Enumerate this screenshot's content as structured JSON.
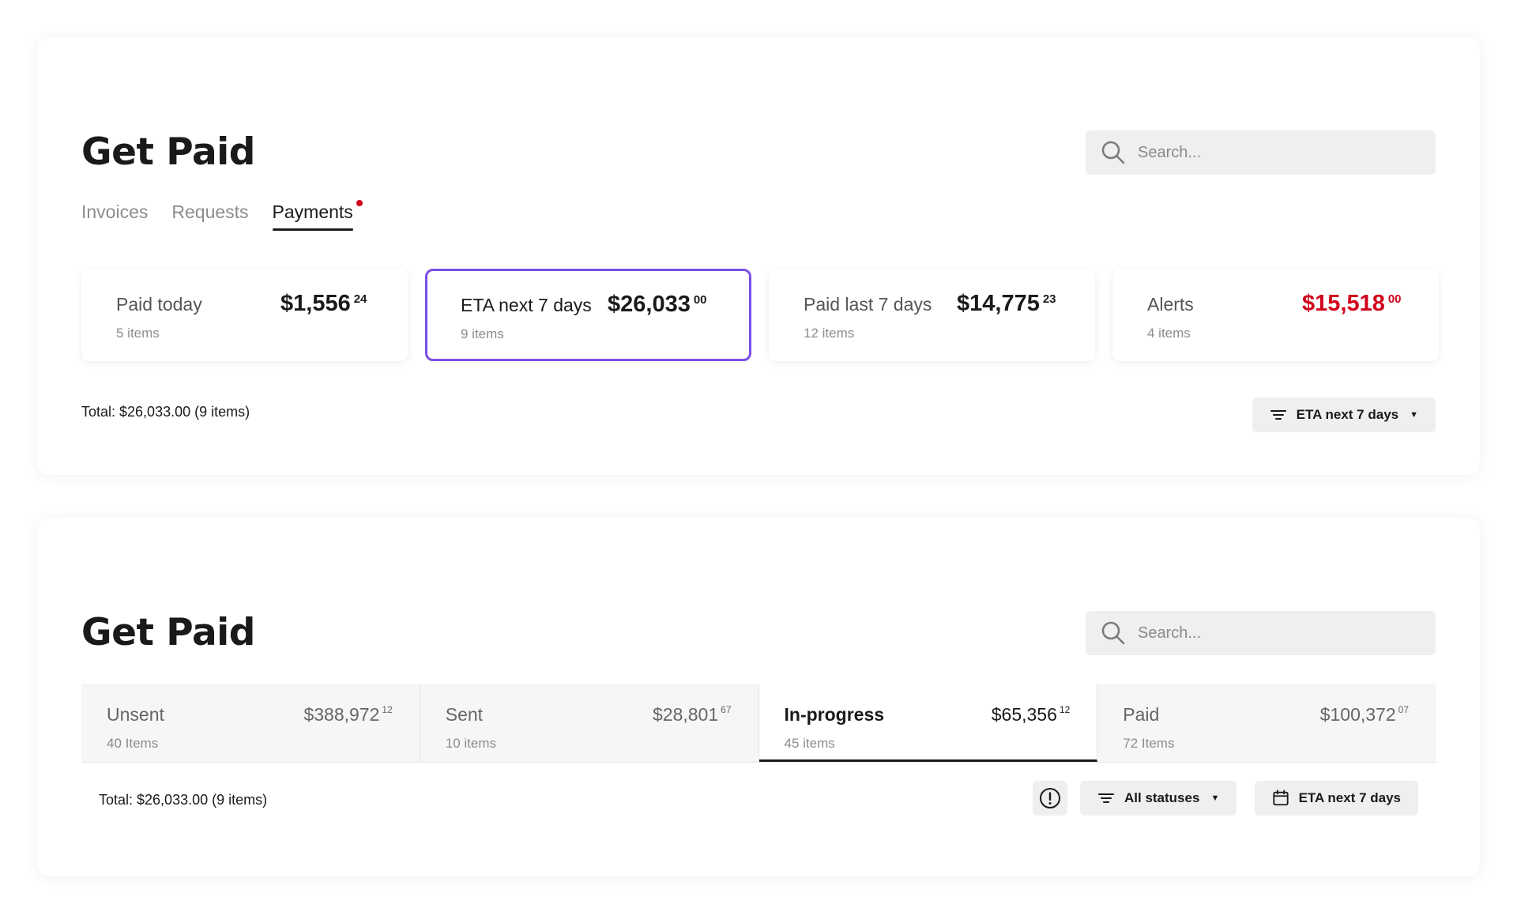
{
  "top": {
    "title": "Get Paid",
    "search": {
      "placeholder": "Search..."
    },
    "tabs": [
      {
        "label": "Invoices",
        "active": false
      },
      {
        "label": "Requests",
        "active": false
      },
      {
        "label": "Payments",
        "active": true,
        "has_notification_dot": true
      }
    ],
    "cards": [
      {
        "label": "Paid today",
        "amount": "$1,556",
        "cents": "24",
        "count": "5 items",
        "selected": false,
        "alert": false
      },
      {
        "label": "ETA next 7 days",
        "amount": "$26,033",
        "cents": "00",
        "count": "9 items",
        "selected": true,
        "alert": false
      },
      {
        "label": "Paid last 7 days",
        "amount": "$14,775",
        "cents": "23",
        "count": "12 items",
        "selected": false,
        "alert": false
      },
      {
        "label": "Alerts",
        "amount": "$15,518",
        "cents": "00",
        "count": "4 items",
        "selected": false,
        "alert": true
      }
    ],
    "total": "Total:  $26,033.00 (9 items)",
    "filter": {
      "label": "ETA next 7 days",
      "icon": "filter-icon"
    }
  },
  "bottom": {
    "title": "Get Paid",
    "search": {
      "placeholder": "Search..."
    },
    "status_tabs": [
      {
        "label": "Unsent",
        "amount": "$388,972",
        "cents": "12",
        "count": "40 Items",
        "active": false
      },
      {
        "label": "Sent",
        "amount": "$28,801",
        "cents": "67",
        "count": "10 items",
        "active": false
      },
      {
        "label": "In-progress",
        "amount": "$65,356",
        "cents": "12",
        "count": "45 items",
        "active": true
      },
      {
        "label": "Paid",
        "amount": "$100,372",
        "cents": "07",
        "count": "72 Items",
        "active": false
      }
    ],
    "total": "Total:  $26,033.00 (9 items)",
    "alert_button": {
      "icon": "alert-circle-icon"
    },
    "status_filter": {
      "label": "All statuses",
      "icon": "filter-icon"
    },
    "date_filter": {
      "label": "ETA next 7 days",
      "icon": "calendar-icon"
    }
  },
  "colors": {
    "accent": "#7b4ee6",
    "alert": "#d0021b",
    "text": "#1a1a1a",
    "muted": "#8c8c8c",
    "control_bg": "#efefef"
  }
}
